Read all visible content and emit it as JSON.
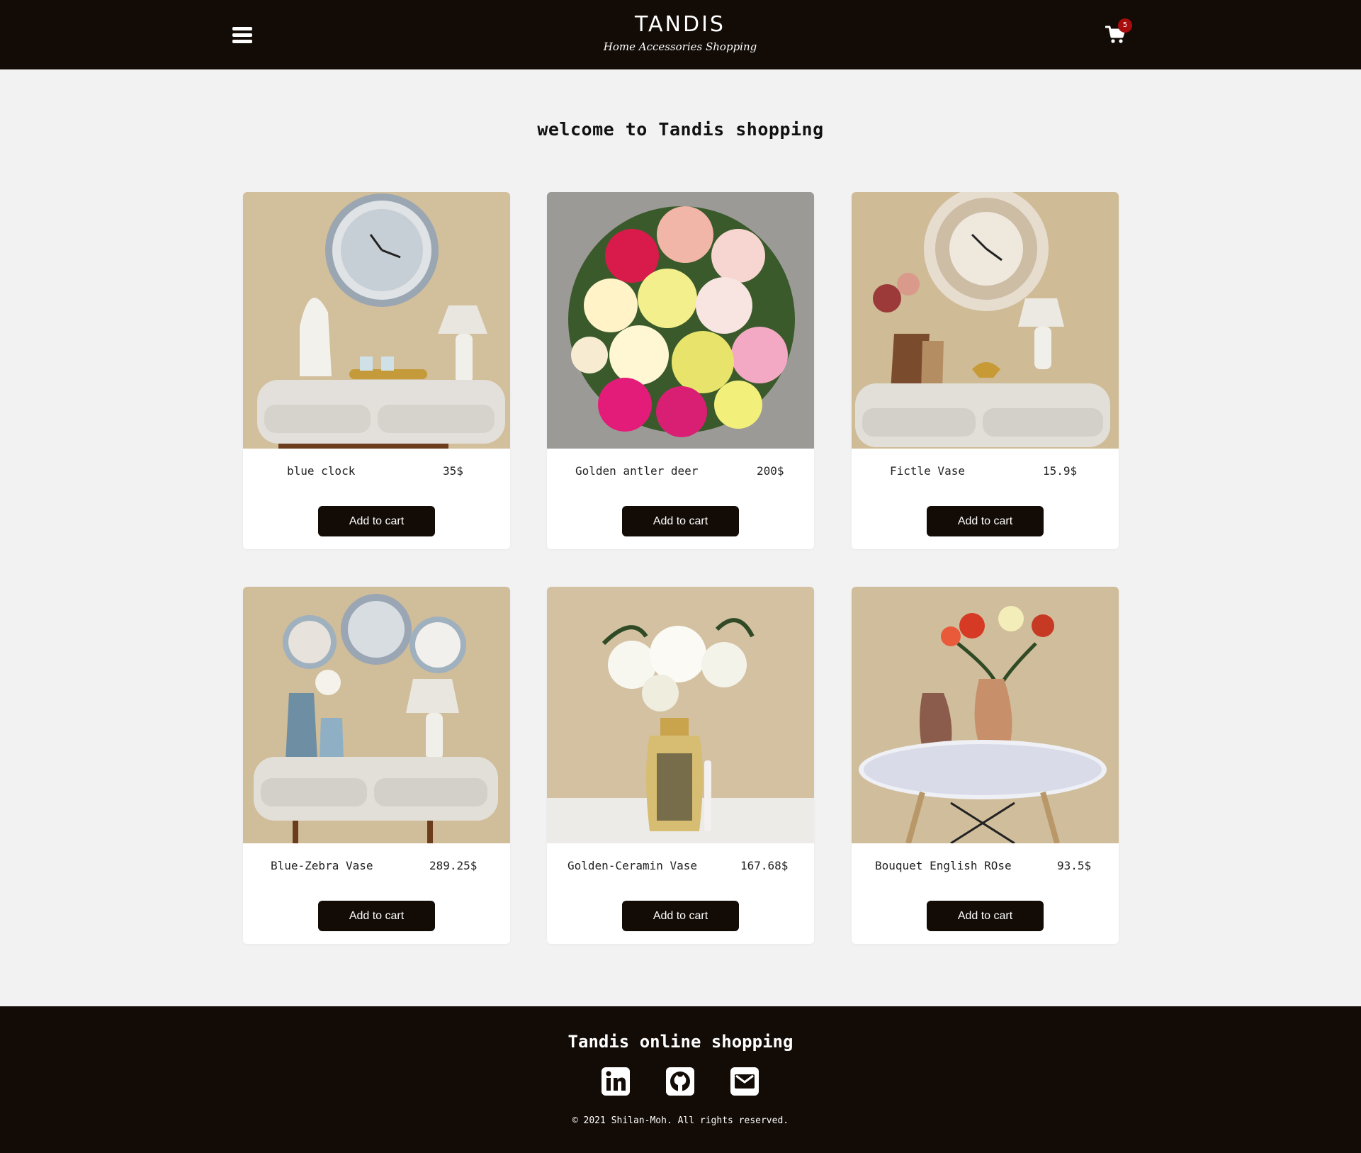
{
  "header": {
    "brand_name": "TANDIS",
    "brand_tagline": "Home Accessories Shopping",
    "menu_icon": "hamburger-menu-icon",
    "cart_icon": "shopping-cart-icon",
    "cart_count": "5"
  },
  "main": {
    "heading": "welcome to Tandis shopping",
    "add_to_cart_label": "Add to cart",
    "products": [
      {
        "name": "blue clock",
        "price": "35$",
        "image": "console table with blue wall clock, deer figurines and lamp"
      },
      {
        "name": "Golden antler deer",
        "price": "200$",
        "image": "bouquet of pink, white and yellow peonies"
      },
      {
        "name": "Fictle Vase",
        "price": "15.9$",
        "image": "console table with Paris wall clock, mosaic vases and lamp"
      },
      {
        "name": "Blue-Zebra Vase",
        "price": "289.25$",
        "image": "console table with three wall clocks, blue vases and lamp"
      },
      {
        "name": "Golden-Ceramin Vase",
        "price": "167.68$",
        "image": "golden patterned vase with white magnolias"
      },
      {
        "name": "Bouquet English ROse",
        "price": "93.5$",
        "image": "round white table with copper vases and roses"
      }
    ]
  },
  "footer": {
    "title": "Tandis online shopping",
    "social_icons": [
      "linkedin-icon",
      "github-icon",
      "mail-icon"
    ],
    "copyright": "© 2021 Shilan-Moh. All rights reserved."
  },
  "colors": {
    "header_bg": "#120b06",
    "page_bg": "#f2f2f2",
    "button_bg": "#120b06",
    "badge_bg": "#a80d0d"
  }
}
